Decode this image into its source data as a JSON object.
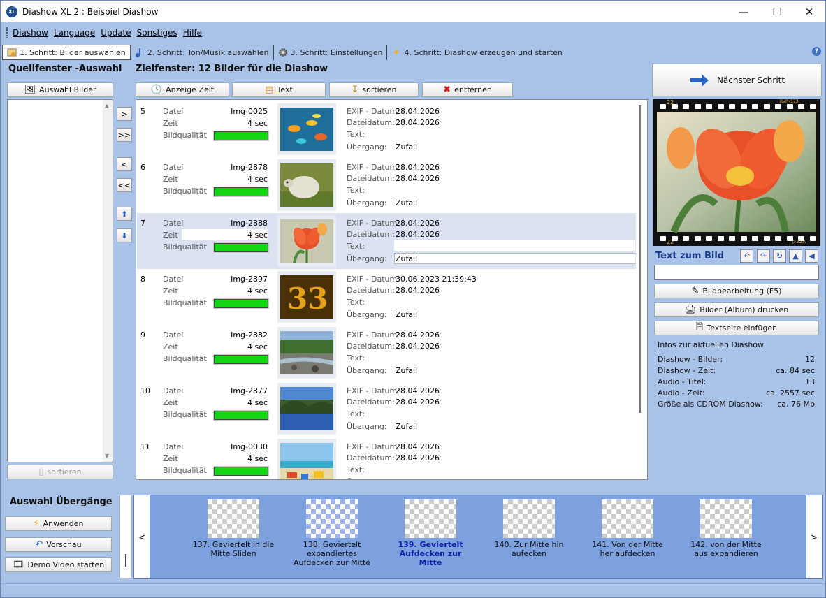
{
  "window": {
    "title": "Diashow XL 2 : Beispiel Diashow",
    "app_icon": "XL"
  },
  "menu": [
    "Diashow",
    "Language",
    "Update",
    "Sonstiges",
    "Hilfe"
  ],
  "tabs": [
    {
      "label": "1. Schritt: Bilder auswählen",
      "icon": "image-icon",
      "active": true
    },
    {
      "label": "2. Schritt: Ton/Musik auswählen",
      "icon": "music-icon",
      "active": false
    },
    {
      "label": "3. Schritt: Einstellungen",
      "icon": "gear-icon",
      "active": false
    },
    {
      "label": "4. Schritt: Diashow erzeugen und starten",
      "icon": "lightning-icon",
      "active": false
    }
  ],
  "source": {
    "header": "Quellfenster -Auswahl",
    "select_button": "Auswahl Bilder",
    "sort_button": "sortieren"
  },
  "target": {
    "header": "Zielfenster: 12 Bilder für die Diashow",
    "toolbar": {
      "time": "Anzeige Zeit",
      "text": "Text",
      "sort": "sortieren",
      "remove": "entfernen"
    },
    "row_labels": {
      "file": "Datei",
      "time": "Zeit",
      "quality": "Bildqualität",
      "exif": "EXIF - Datum:",
      "filedate": "Dateidatum:",
      "text": "Text:",
      "transition": "Übergang:"
    },
    "rows": [
      {
        "num": "5",
        "file": "Img-0025",
        "time": "4 sec",
        "quality": 1.0,
        "exif": "28.04.2026",
        "filedate": "28.04.2026",
        "text": "",
        "transition": "Zufall",
        "thumb": "fish"
      },
      {
        "num": "6",
        "file": "Img-2878",
        "time": "4 sec",
        "quality": 1.0,
        "exif": "28.04.2026",
        "filedate": "28.04.2026",
        "text": "",
        "transition": "Zufall",
        "thumb": "sheep"
      },
      {
        "num": "7",
        "file": "Img-2888",
        "time": "4 sec",
        "quality": 1.0,
        "exif": "28.04.2026",
        "filedate": "28.04.2026",
        "text": "",
        "transition": "Zufall",
        "thumb": "tulip",
        "selected": true
      },
      {
        "num": "8",
        "file": "Img-2897",
        "time": "4 sec",
        "quality": 1.0,
        "exif": "30.06.2023 21:39:43",
        "filedate": "28.04.2026",
        "text": "",
        "transition": "Zufall",
        "thumb": "gold"
      },
      {
        "num": "9",
        "file": "Img-2882",
        "time": "4 sec",
        "quality": 1.0,
        "exif": "28.04.2026",
        "filedate": "28.04.2026",
        "text": "",
        "transition": "Zufall",
        "thumb": "river"
      },
      {
        "num": "10",
        "file": "Img-2877",
        "time": "4 sec",
        "quality": 1.0,
        "exif": "28.04.2026",
        "filedate": "28.04.2026",
        "text": "",
        "transition": "Zufall",
        "thumb": "lake"
      },
      {
        "num": "11",
        "file": "Img-0030",
        "time": "4 sec",
        "quality": 1.0,
        "exif": "28.04.2026",
        "filedate": "28.04.2026",
        "text": "",
        "transition": "Zufall",
        "thumb": "beach"
      }
    ]
  },
  "move_buttons": [
    ">",
    ">>",
    "<",
    "<<"
  ],
  "right": {
    "next_step": "Nächster Schritt",
    "film_labels": {
      "top_left": "22",
      "top_right": "RVP•573",
      "bottom_left": "22",
      "bottom_right": "▷22A"
    },
    "text_header": "Text zum Bild",
    "text_value": "",
    "buttons": [
      "Bildbearbeitung (F5)",
      "Bilder (Album) drucken",
      "Textseite einfügen"
    ],
    "info_header": "Infos zur aktuellen Diashow",
    "info": [
      {
        "label": "Diashow - Bilder:",
        "value": "12"
      },
      {
        "label": "Diashow - Zeit:",
        "value": "ca. 84 sec"
      },
      {
        "label": "Audio - Titel:",
        "value": "13"
      },
      {
        "label": "Audio - Zeit:",
        "value": "ca. 2557 sec"
      },
      {
        "label": "Größe als CDROM Diashow:",
        "value": "ca. 76 Mb"
      }
    ]
  },
  "transitions": {
    "header": "Auswahl Übergänge",
    "buttons": [
      "Anwenden",
      "Vorschau",
      "Demo Video starten"
    ],
    "items": [
      {
        "label": "137. Geviertelt in die Mitte Sliden",
        "selected": false,
        "style": "gray"
      },
      {
        "label": "138. Geviertelt expandiertes Aufdecken zur Mitte",
        "selected": false,
        "style": "blue"
      },
      {
        "label": "139. Geviertelt Aufdecken zur Mitte",
        "selected": true,
        "style": "gray"
      },
      {
        "label": "140. Zur Mitte hin aufecken",
        "selected": false,
        "style": "gray"
      },
      {
        "label": "141. Von der Mitte her aufdecken",
        "selected": false,
        "style": "gray"
      },
      {
        "label": "142. von der Mitte aus expandieren",
        "selected": false,
        "style": "gray"
      }
    ],
    "prev": "<",
    "next": ">"
  }
}
